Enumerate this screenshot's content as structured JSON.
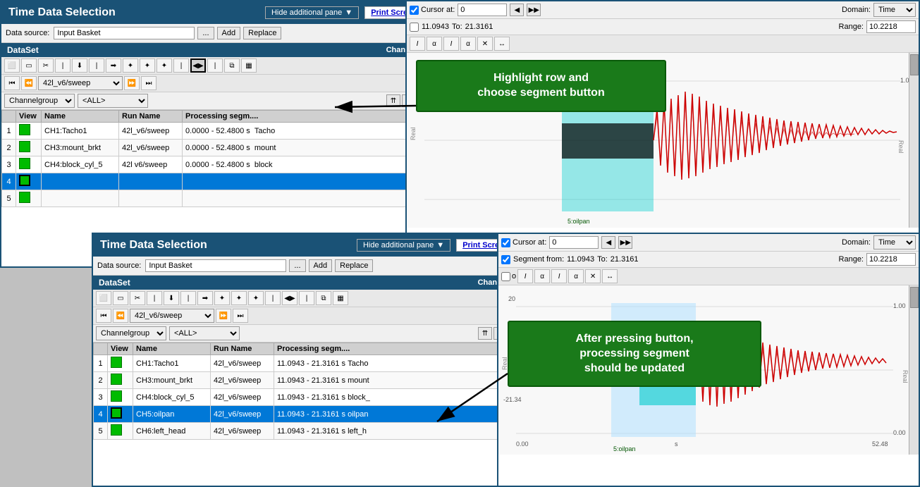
{
  "top_panel": {
    "title": "Time Data Selection",
    "header": {
      "hide_pane": "Hide additional pane",
      "print_screen": "Print Screen",
      "help": "?"
    },
    "datasource": {
      "label": "Data source:",
      "value": "Input Basket",
      "add_btn": "Add",
      "replace_btn": "Replace"
    },
    "dataset_bar": {
      "label": "DataSet",
      "channels_list": "Channels list"
    },
    "sweep_select": "42l_v6/sweep",
    "filter": {
      "channelgroup": "Channelgroup",
      "all": "<ALL>"
    },
    "chart_controls": {
      "cursor_label": "Cursor at:",
      "cursor_value": "0",
      "domain_label": "Domain:",
      "domain_value": "Time",
      "range_label": "Range:",
      "range_value": "10.2218"
    },
    "table": {
      "headers": [
        "",
        "View",
        "Name",
        "Run Name",
        "Processing segm...."
      ],
      "rows": [
        {
          "num": "1",
          "name": "CH1:Tacho1",
          "run": "42l_v6/sweep",
          "proc": "0.0000 - 52.4800 s",
          "extra": "Tacho",
          "selected": false
        },
        {
          "num": "2",
          "name": "CH3:mount_brkt",
          "run": "42l_v6/sweep",
          "proc": "0.0000 - 52.4800 s",
          "extra": "mount",
          "selected": false
        },
        {
          "num": "3",
          "name": "CH4:block_cyl_5",
          "run": "42l v6/sweep",
          "proc": "0.0000 - 52.4800 s",
          "extra": "block",
          "selected": false
        },
        {
          "num": "4",
          "name": "",
          "run": "",
          "proc": "",
          "extra": "",
          "selected": true
        },
        {
          "num": "5",
          "name": "",
          "run": "",
          "proc": "",
          "extra": "",
          "selected": false
        }
      ]
    }
  },
  "bottom_panel": {
    "title": "Time Data Selection",
    "header": {
      "hide_pane": "Hide additional pane",
      "print_screen": "Print Screen",
      "help": "?"
    },
    "datasource": {
      "label": "Data source:",
      "value": "Input Basket",
      "add_btn": "Add",
      "replace_btn": "Replace"
    },
    "dataset_bar": {
      "label": "DataSet",
      "channels_list": "Channels list"
    },
    "sweep_select": "42l_v6/sweep",
    "filter": {
      "channelgroup": "Channelgroup",
      "all": "<ALL>"
    },
    "chart_controls": {
      "cursor_label": "Cursor at:",
      "cursor_value": "0",
      "segment_label": "Segment from:",
      "segment_from": "11.0943",
      "to_label": "To:",
      "to_value": "21.3161",
      "domain_label": "Domain:",
      "domain_value": "Time",
      "range_label": "Range:",
      "range_value": "10.2218"
    },
    "table": {
      "headers": [
        "",
        "View",
        "Name",
        "Run Name",
        "Processing segm...."
      ],
      "rows": [
        {
          "num": "1",
          "name": "CH1:Tacho1",
          "run": "42l_v6/sweep",
          "proc": "11.0943 - 21.3161 s",
          "extra": "Tacho",
          "selected": false
        },
        {
          "num": "2",
          "name": "CH3:mount_brkt",
          "run": "42l_v6/sweep",
          "proc": "11.0943 - 21.3161 s",
          "extra": "mount",
          "selected": false
        },
        {
          "num": "3",
          "name": "CH4:block_cyl_5",
          "run": "42l_v6/sweep",
          "proc": "11.0943 - 21.3161 s",
          "extra": "block_",
          "selected": false
        },
        {
          "num": "4",
          "name": "CH5:oilpan",
          "run": "42l_v6/sweep",
          "proc": "11.0943 - 21.3161 s",
          "extra": "oilpan",
          "selected": true
        },
        {
          "num": "5",
          "name": "CH6:left_head",
          "run": "42l_v6/sweep",
          "proc": "11.0943 - 21.3161 s",
          "extra": "left_h",
          "selected": false
        }
      ]
    }
  },
  "annotation1": {
    "text": "Highlight row and\nchoose segment button"
  },
  "annotation2": {
    "text": "After pressing button,\nprocessing segment\nshould be updated"
  }
}
